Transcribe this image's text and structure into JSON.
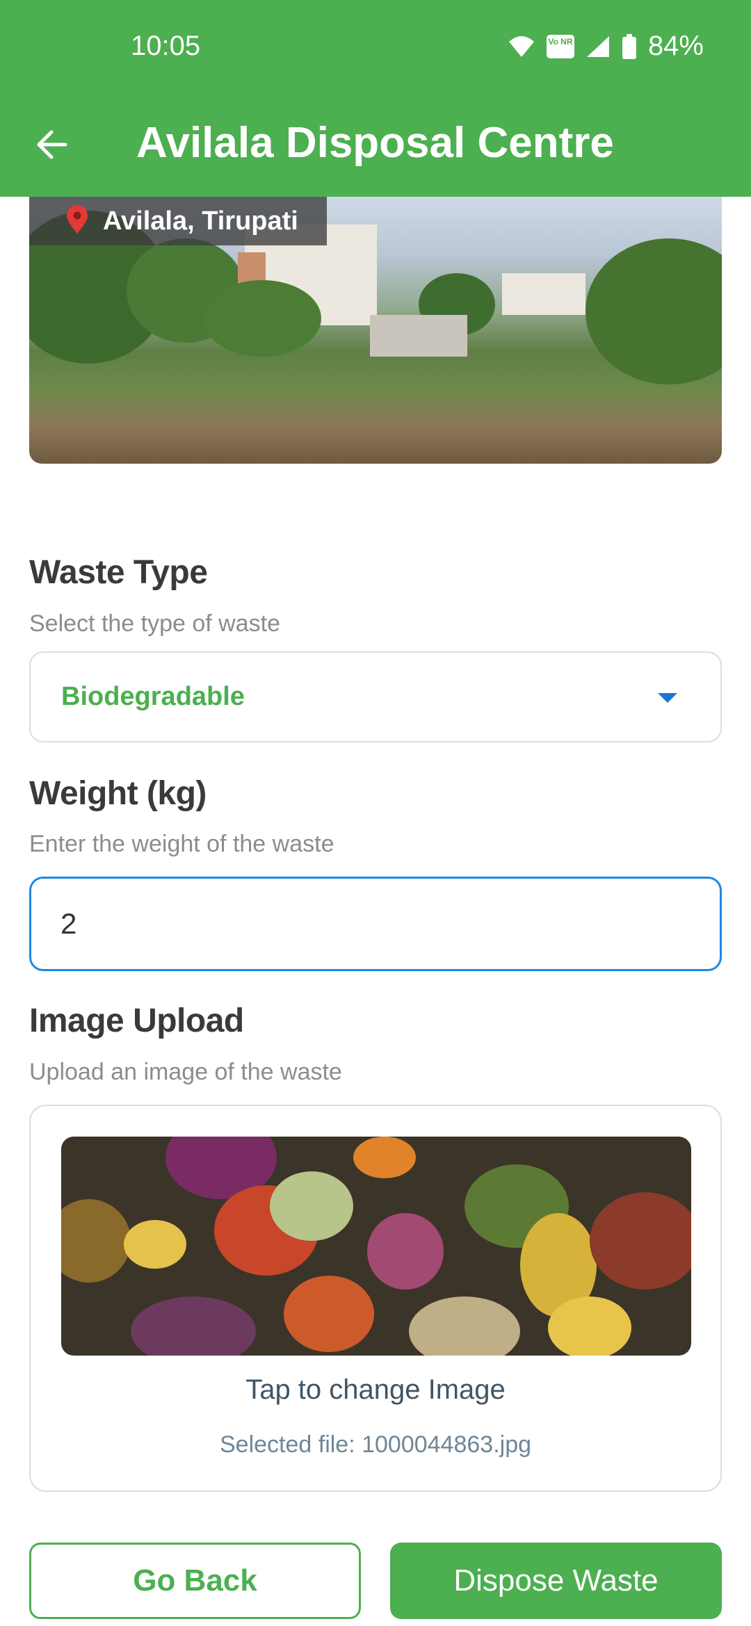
{
  "status_bar": {
    "time": "10:05",
    "volte_label": "Vo NR",
    "battery": "84%"
  },
  "header": {
    "title": "Avilala Disposal Centre"
  },
  "location": {
    "label": "Avilala, Tirupati"
  },
  "waste_type": {
    "title": "Waste Type",
    "subtitle": "Select the type of waste",
    "selected": "Biodegradable"
  },
  "weight": {
    "title": "Weight (kg)",
    "subtitle": "Enter the weight of the waste",
    "value": "2"
  },
  "image_upload": {
    "title": "Image Upload",
    "subtitle": "Upload an image of the waste",
    "tap_text": "Tap to change Image",
    "file_text": "Selected file: 1000044863.jpg"
  },
  "actions": {
    "back_label": "Go Back",
    "dispose_label": "Dispose Waste"
  },
  "colors": {
    "primary": "#4CAF50",
    "focus": "#1E88E5"
  }
}
